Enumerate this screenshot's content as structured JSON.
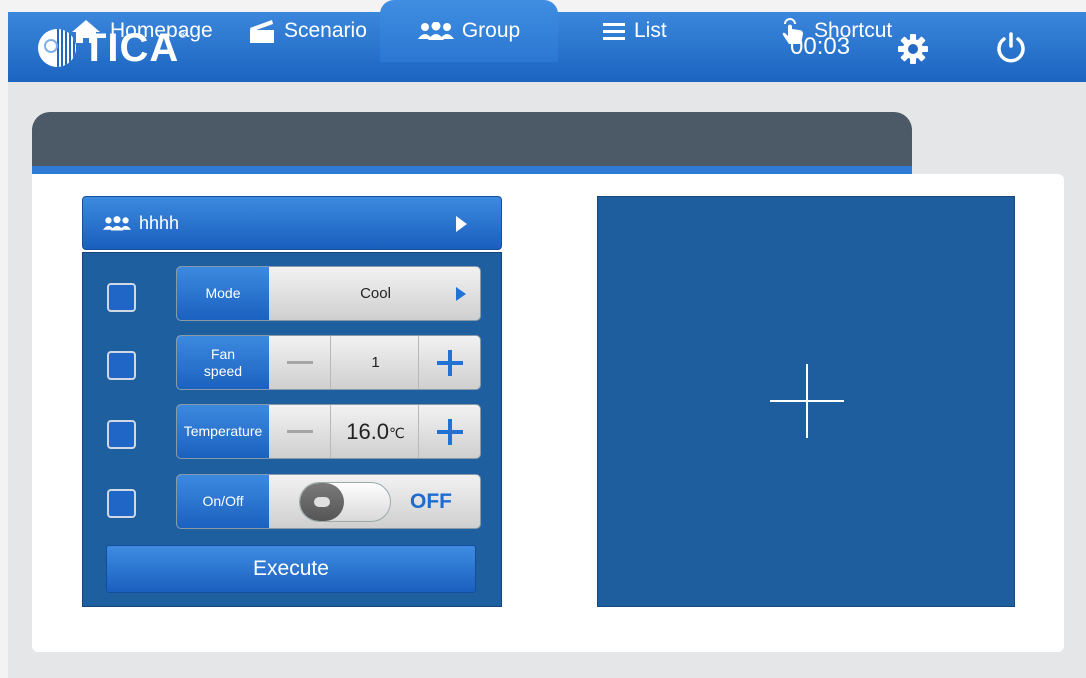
{
  "header": {
    "brand": "TICA",
    "brand_mark": "®",
    "time": "00:03",
    "settings_icon": "gear-icon",
    "power_icon": "power-icon",
    "color": "#2a74d0"
  },
  "tabs": [
    {
      "label": "Homepage",
      "icon": "home-icon",
      "active": false
    },
    {
      "label": "Scenario",
      "icon": "clapperboard-icon",
      "active": false
    },
    {
      "label": "Group",
      "icon": "group-icon",
      "active": true
    },
    {
      "label": "List",
      "icon": "list-icon",
      "active": false
    },
    {
      "label": "Shortcut",
      "icon": "tap-hand-icon",
      "active": false
    }
  ],
  "group": {
    "name": "hhhh",
    "controls": {
      "mode": {
        "label": "Mode",
        "value": "Cool"
      },
      "fan_speed": {
        "label": "Fan\nspeed",
        "value": "1"
      },
      "temperature": {
        "label": "Temperature",
        "value": "16.0",
        "unit": "℃"
      },
      "onoff": {
        "label": "On/Off",
        "value": "OFF"
      }
    },
    "execute_label": "Execute"
  },
  "add_panel": {
    "icon": "plus-icon"
  }
}
